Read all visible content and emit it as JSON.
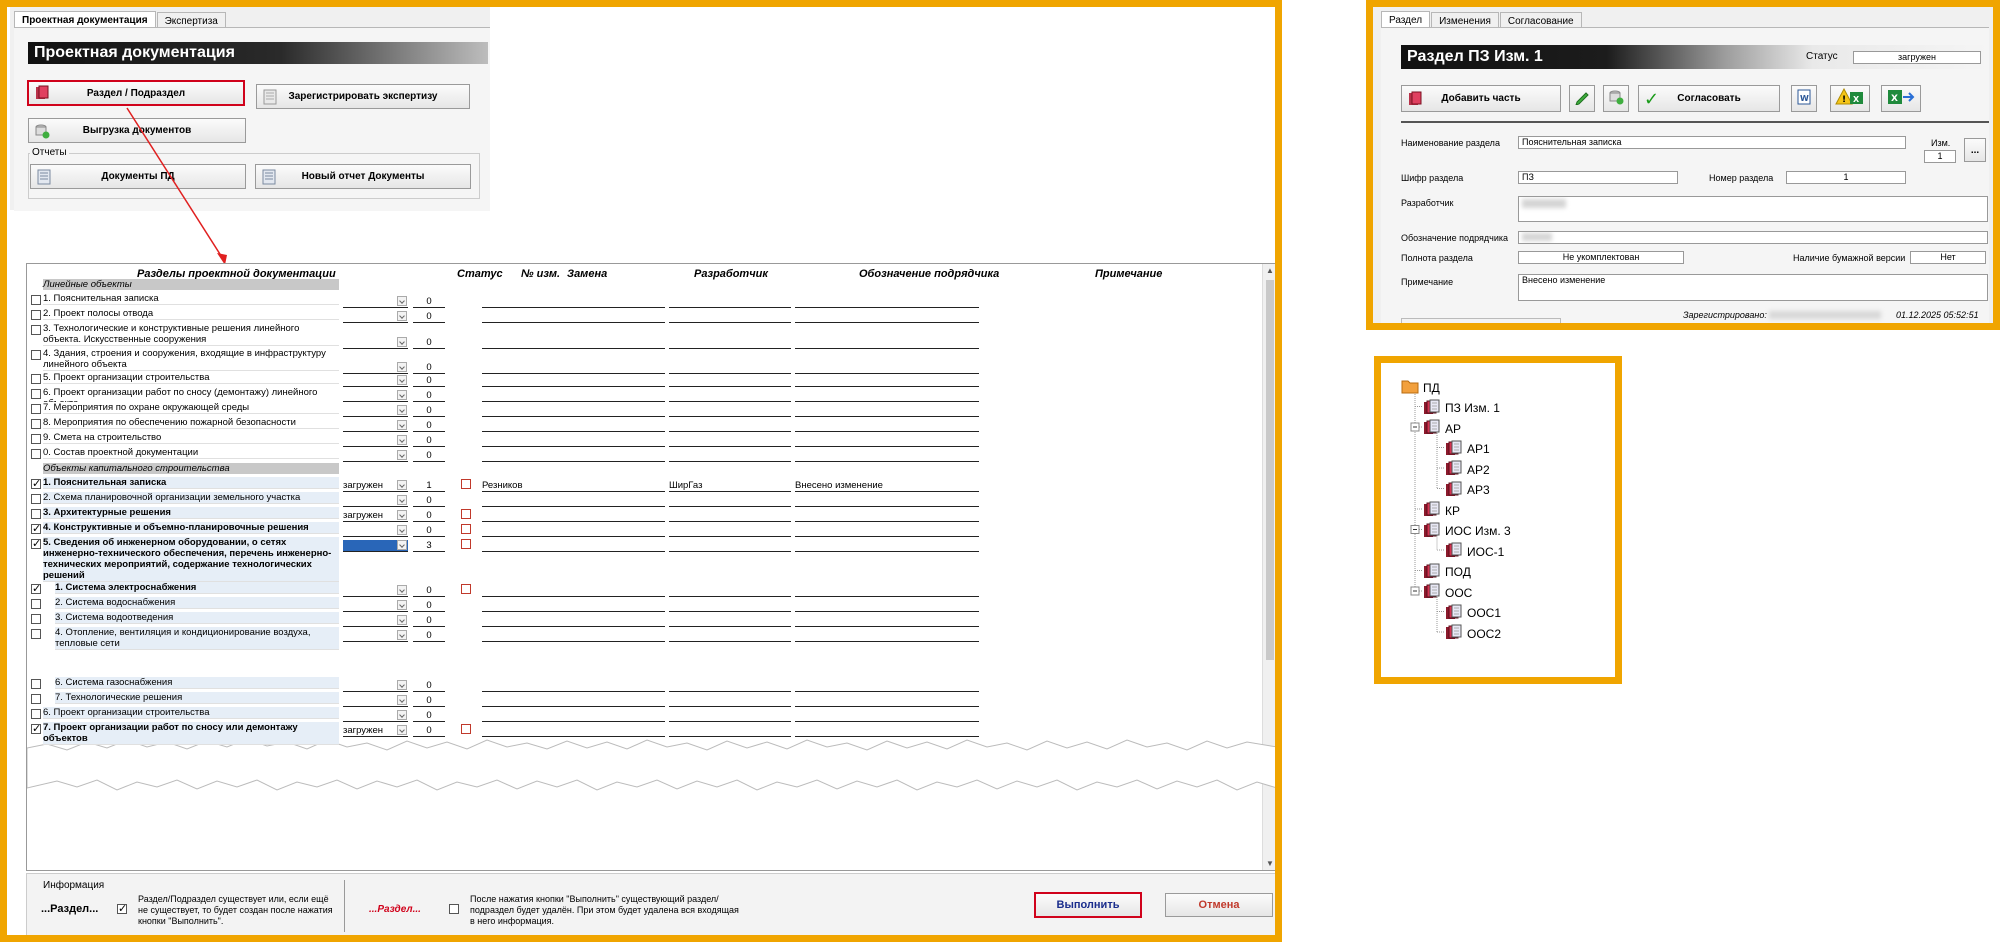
{
  "colors": {
    "frame": "#f0a500",
    "accent_red": "#d0021b",
    "header_dark": "#1a1a1a"
  },
  "main": {
    "tabs": [
      {
        "label": "Проектная документация"
      },
      {
        "label": "Экспертиза"
      }
    ],
    "title": "Проектная документация",
    "buttons": {
      "section": "Раздел / Подраздел",
      "register": "Зарегистрировать экспертизу",
      "export": "Выгрузка документов",
      "docs_pd": "Документы ПД",
      "new_report": "Новый отчет Документы"
    },
    "reports_label": "Отчеты",
    "table": {
      "headers": [
        "Разделы проектной документации",
        "Статус",
        "№ изм.",
        "Замена",
        "Разработчик",
        "Обозначение подрядчика",
        "Примечание"
      ],
      "group_linear": "Линейные объекты",
      "linear_rows": [
        {
          "name": "1. Пояснительная записка",
          "num": "0"
        },
        {
          "name": "2. Проект полосы отвода",
          "num": "0"
        },
        {
          "name": "3. Технологические и конструктивные решения линейного объекта. Искусственные сооружения",
          "num": "0"
        },
        {
          "name": "4. Здания, строения и сооружения, входящие в инфраструктуру линейного объекта",
          "num": "0"
        },
        {
          "name": "5. Проект организации строительства",
          "num": "0"
        },
        {
          "name": "6. Проект организации работ по сносу (демонтажу) линейного объекта",
          "num": "0"
        },
        {
          "name": "7. Мероприятия по охране окружающей среды",
          "num": "0"
        },
        {
          "name": "8. Мероприятия по обеспечению пожарной безопасности",
          "num": "0"
        },
        {
          "name": "9. Смета на строительство",
          "num": "0"
        },
        {
          "name": "0. Состав проектной документации",
          "num": "0"
        }
      ],
      "group_capital": "Объекты капитального строительства",
      "capital_rows": [
        {
          "name": "1. Пояснительная записка",
          "status": "загружен",
          "num": "1",
          "dev": "Резников",
          "contractor": "ШирГаз",
          "note": "Внесено изменение"
        },
        {
          "name": "2. Схема планировочной организации земельного участка",
          "status": "",
          "num": "0",
          "dev": "",
          "contractor": "",
          "note": ""
        },
        {
          "name": "3. Архитектурные решения",
          "status": "загружен",
          "num": "0",
          "dev": "",
          "contractor": "",
          "note": ""
        },
        {
          "name": "4. Конструктивные и объемно-планировочные решения",
          "status": "",
          "num": "0",
          "dev": "",
          "contractor": "",
          "note": ""
        },
        {
          "name": "5. Сведения об инженерном оборудовании, о сетях инженерно-технического обеспечения, перечень инженерно-технических мероприятий, содержание технологических решений",
          "status": "",
          "num": "3",
          "dev": "",
          "contractor": "",
          "note": ""
        },
        {
          "name": "1. Система электроснабжения",
          "status": "",
          "num": "0",
          "dev": "",
          "contractor": "",
          "note": ""
        },
        {
          "name": "2. Система водоснабжения",
          "status": "",
          "num": "0",
          "dev": "",
          "contractor": "",
          "note": ""
        },
        {
          "name": "3. Система водоотведения",
          "status": "",
          "num": "0",
          "dev": "",
          "contractor": "",
          "note": ""
        },
        {
          "name": "4. Отопление, вентиляция и кондиционирование воздуха, тепловые сети",
          "status": "",
          "num": "0",
          "dev": "",
          "contractor": "",
          "note": ""
        }
      ],
      "bottom_rows": [
        {
          "name": "6. Система газоснабжения",
          "status": "",
          "num": "0"
        },
        {
          "name": "7. Технологические решения",
          "status": "",
          "num": "0"
        },
        {
          "name": "6. Проект организации строительства",
          "status": "",
          "num": "0"
        },
        {
          "name": "7. Проект организации работ по сносу или демонтажу объектов",
          "status": "загружен",
          "num": "0"
        }
      ]
    },
    "info": {
      "title": "Информация",
      "left_key": "...Раздел...",
      "left_text": "Раздел/Подраздел существует или, если ещё не существует, то будет создан после нажатия кнопки \"Выполнить\".",
      "right_key": "...Раздел...",
      "right_text": "После нажатия кнопки \"Выполнить\" существующий раздел/подраздел будет удалён. При этом будет удалена вся входящая в него информация."
    },
    "execute": "Выполнить",
    "cancel": "Отмена"
  },
  "section_panel": {
    "tabs": [
      {
        "label": "Раздел"
      },
      {
        "label": "Изменения"
      },
      {
        "label": "Согласование"
      }
    ],
    "title": "Раздел  ПЗ Изм. 1",
    "status_label": "Статус",
    "status_value": "загружен",
    "add_part": "Добавить часть",
    "approve": "Согласовать",
    "name_label": "Наименование раздела",
    "name_value": "Пояснительная записка",
    "izm_label": "Изм.",
    "izm_value": "1",
    "cipher_label": "Шифр раздела",
    "cipher_value": "ПЗ",
    "number_label": "Номер раздела",
    "number_value": "1",
    "developer_label": "Разработчик",
    "contractor_label": "Обозначение подрядчика",
    "completeness_label": "Полнота раздела",
    "completeness_value": "Не укомплектован",
    "paper_label": "Наличие бумажной версии",
    "paper_value": "Нет",
    "note_label": "Примечание",
    "note_value": "Внесено изменение",
    "registered_label": "Зарегистрировано:",
    "registered_date": "01.12.2025 05:52:51"
  },
  "tree": {
    "items": [
      {
        "label": "ПД",
        "level": 0,
        "kind": "folder"
      },
      {
        "label": "ПЗ Изм. 1",
        "level": 1,
        "kind": "book"
      },
      {
        "label": "АР",
        "level": 1,
        "kind": "book"
      },
      {
        "label": "АР1",
        "level": 2,
        "kind": "book"
      },
      {
        "label": "АР2",
        "level": 2,
        "kind": "book"
      },
      {
        "label": "АР3",
        "level": 2,
        "kind": "book"
      },
      {
        "label": "КР",
        "level": 1,
        "kind": "book"
      },
      {
        "label": "ИОС Изм. 3",
        "level": 1,
        "kind": "book"
      },
      {
        "label": "ИОС-1",
        "level": 2,
        "kind": "book"
      },
      {
        "label": "ПОД",
        "level": 1,
        "kind": "book"
      },
      {
        "label": "ООС",
        "level": 1,
        "kind": "book"
      },
      {
        "label": "ООС1",
        "level": 2,
        "kind": "book"
      },
      {
        "label": "ООС2",
        "level": 2,
        "kind": "book"
      }
    ]
  }
}
